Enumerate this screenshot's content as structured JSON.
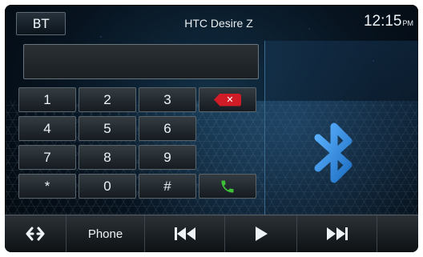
{
  "header": {
    "source_label": "BT",
    "device_name": "HTC Desire Z",
    "time": "12:15",
    "ampm": "PM"
  },
  "display": {
    "number": ""
  },
  "keypad": {
    "keys": [
      "1",
      "2",
      "3",
      "4",
      "5",
      "6",
      "7",
      "8",
      "9",
      "*",
      "0",
      "#"
    ],
    "delete_icon": "backspace-icon",
    "call_icon": "phone-call-icon"
  },
  "bottom_bar": {
    "items": [
      {
        "icon": "swap-arrows-icon"
      },
      {
        "label": "Phone"
      },
      {
        "icon": "previous-track-icon"
      },
      {
        "icon": "play-icon"
      },
      {
        "icon": "next-track-icon"
      }
    ]
  },
  "colors": {
    "delete_red": "#d01c26",
    "call_green": "#3fbf3a",
    "bluetooth_blue": "#2f8fe6"
  },
  "panel": {
    "icon": "bluetooth-icon"
  }
}
